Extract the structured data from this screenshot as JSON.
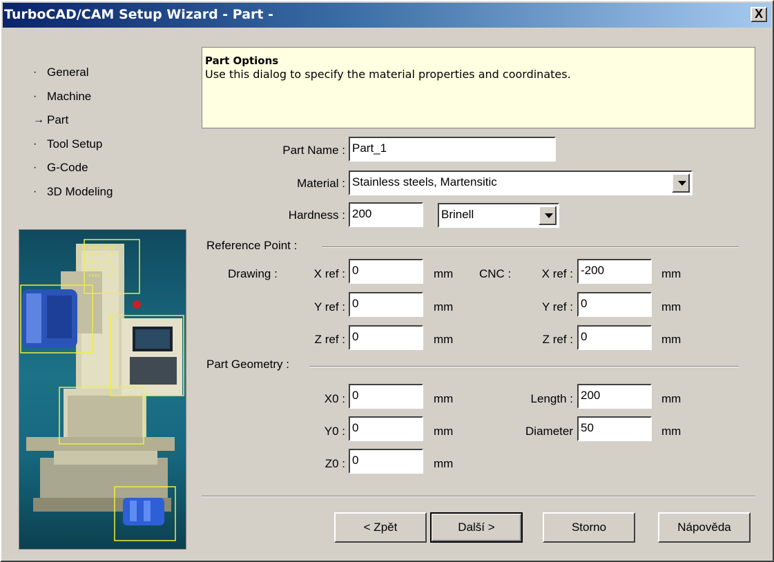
{
  "window": {
    "title": "TurboCAD/CAM Setup Wizard - Part -",
    "close_label": "X"
  },
  "nav": {
    "items": [
      {
        "label": "General",
        "marker": "·",
        "active": false
      },
      {
        "label": "Machine",
        "marker": "·",
        "active": false
      },
      {
        "label": "Part",
        "marker": "→",
        "active": true
      },
      {
        "label": "Tool Setup",
        "marker": "·",
        "active": false
      },
      {
        "label": "G-Code",
        "marker": "·",
        "active": false
      },
      {
        "label": "3D Modeling",
        "marker": "·",
        "active": false
      }
    ]
  },
  "info": {
    "title": "Part Options",
    "text": "Use this dialog to specify the material properties and coordinates."
  },
  "form": {
    "part_name_label": "Part Name :",
    "part_name_value": "Part_1",
    "material_label": "Material :",
    "material_value": "Stainless steels, Martensitic",
    "hardness_label": "Hardness :",
    "hardness_value": "200",
    "hardness_unit_value": "Brinell"
  },
  "reference": {
    "section_label": "Reference Point :",
    "drawing_label": "Drawing :",
    "cnc_label": "CNC :",
    "x_label": "X ref :",
    "y_label": "Y ref :",
    "z_label": "Z ref :",
    "drawing_x": "0",
    "drawing_y": "0",
    "drawing_z": "0",
    "cnc_x": "-200",
    "cnc_y": "0",
    "cnc_z": "0",
    "unit": "mm"
  },
  "geometry": {
    "section_label": "Part Geometry :",
    "x0_label": "X0 :",
    "x0_value": "0",
    "y0_label": "Y0 :",
    "y0_value": "0",
    "z0_label": "Z0 :",
    "z0_value": "0",
    "length_label": "Length :",
    "length_value": "200",
    "diameter_label": "Diameter",
    "diameter_value": "50",
    "unit": "mm"
  },
  "buttons": {
    "back": "< Zpět",
    "next": "Další >",
    "cancel": "Storno",
    "help": "Nápověda"
  },
  "art": {
    "screen_lines": [
      "xxxx 1x/1",
      "xxxx ~ 121",
      "xxx ~ 56",
      "xxx/x ~ 0",
      "xxxx ~ 1.1"
    ]
  },
  "colors": {
    "dialog_bg": "#d4d0c8",
    "info_bg": "#ffffe1",
    "title_start": "#0a246a",
    "title_end": "#a6caf0"
  }
}
